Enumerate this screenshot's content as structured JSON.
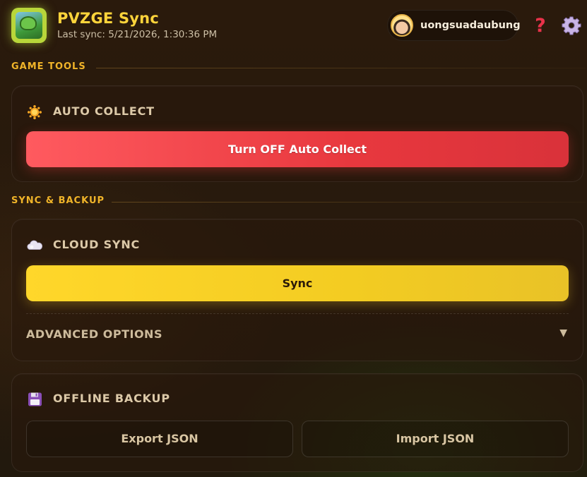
{
  "header": {
    "title": "PVZGE Sync",
    "last_sync": "Last sync: 5/21/2026, 1:30:36 PM",
    "username": "uongsuadaubung",
    "help_glyph": "?",
    "logo_icon": "plants-vs-zombies-logo",
    "settings_icon": "gear-icon"
  },
  "sections": {
    "game_tools": {
      "label": "GAME TOOLS",
      "auto_collect": {
        "title": "AUTO COLLECT",
        "icon": "sun-icon",
        "button_label": "Turn OFF Auto Collect"
      }
    },
    "sync_backup": {
      "label": "SYNC & BACKUP",
      "cloud_sync": {
        "title": "CLOUD SYNC",
        "icon": "cloud-icon",
        "button_label": "Sync",
        "advanced_label": "ADVANCED OPTIONS",
        "advanced_chevron": "▼"
      },
      "offline_backup": {
        "title": "OFFLINE BACKUP",
        "icon": "floppy-disk-icon",
        "export_label": "Export JSON",
        "import_label": "Import JSON"
      }
    }
  },
  "colors": {
    "accent_yellow": "#ffd43b",
    "section_label": "#f0b429",
    "danger_red": "#e8383e",
    "sync_yellow": "#f3cc22",
    "help_red": "#e8324a",
    "gear_lilac": "#c9b4e6"
  }
}
